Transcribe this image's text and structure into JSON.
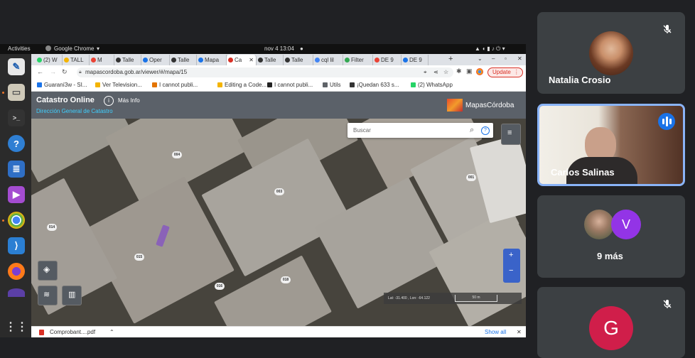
{
  "os": {
    "activities": "Activities",
    "app_name": "Google Chrome",
    "clock": "nov 4  13:04"
  },
  "browser": {
    "tabs": [
      {
        "label": "(2) W",
        "color": "#25d366"
      },
      {
        "label": "TALL",
        "color": "#f4b400"
      },
      {
        "label": "M",
        "color": "#ea4335"
      },
      {
        "label": "Talle",
        "color": "#333333"
      },
      {
        "label": "Oper",
        "color": "#1a73e8"
      },
      {
        "label": "Talle",
        "color": "#333333"
      },
      {
        "label": "Mapa",
        "color": "#1a73e8"
      },
      {
        "label": "Ca",
        "color": "#d93025"
      },
      {
        "label": "Talle",
        "color": "#333333"
      },
      {
        "label": "Talle",
        "color": "#333333"
      },
      {
        "label": "cql lil",
        "color": "#4285f4"
      },
      {
        "label": "Filter",
        "color": "#34a853"
      },
      {
        "label": "DE 9",
        "color": "#ea4335"
      },
      {
        "label": "DE 9",
        "color": "#1a73e8"
      }
    ],
    "url": "mapascordoba.gob.ar/viewer/#/mapa/15",
    "update_label": "Update",
    "bookmarks": [
      {
        "label": "Guaraní3w - SI...",
        "color": "#1a73e8"
      },
      {
        "label": "Ver Television...",
        "color": "#f4b400"
      },
      {
        "label": "I cannot publi...",
        "color": "#e37400"
      },
      {
        "label": "Editing a Code...",
        "color": "#f4b400"
      },
      {
        "label": "I cannot publi...",
        "color": "#222222"
      },
      {
        "label": "Utils",
        "color": "#5f6368"
      },
      {
        "label": "¡Quedan  633 s...",
        "color": "#333333"
      },
      {
        "label": "(2) WhatsApp",
        "color": "#25d366"
      }
    ],
    "download": {
      "file": "Comprobant....pdf",
      "show_all": "Show all"
    }
  },
  "catastro": {
    "title": "Catastro Online",
    "info_label": "Más Info",
    "subtitle": "Dirección General de Catastro",
    "brand": "MapasCórdoba",
    "search_placeholder": "Buscar",
    "lots": [
      "004",
      "003",
      "001",
      "014",
      "015",
      "016",
      "018"
    ],
    "coords": "Lat: -31.400 , Lon: -64.122",
    "scale": "50 m"
  },
  "meet": {
    "participants": [
      {
        "name": "Natalia Crosio",
        "muted": true
      },
      {
        "name": "Carlos Salinas",
        "speaking": true
      },
      {
        "more_label": "9 más",
        "avatar_letter": "V"
      },
      {
        "avatar_letter": "G",
        "muted": true
      }
    ]
  }
}
